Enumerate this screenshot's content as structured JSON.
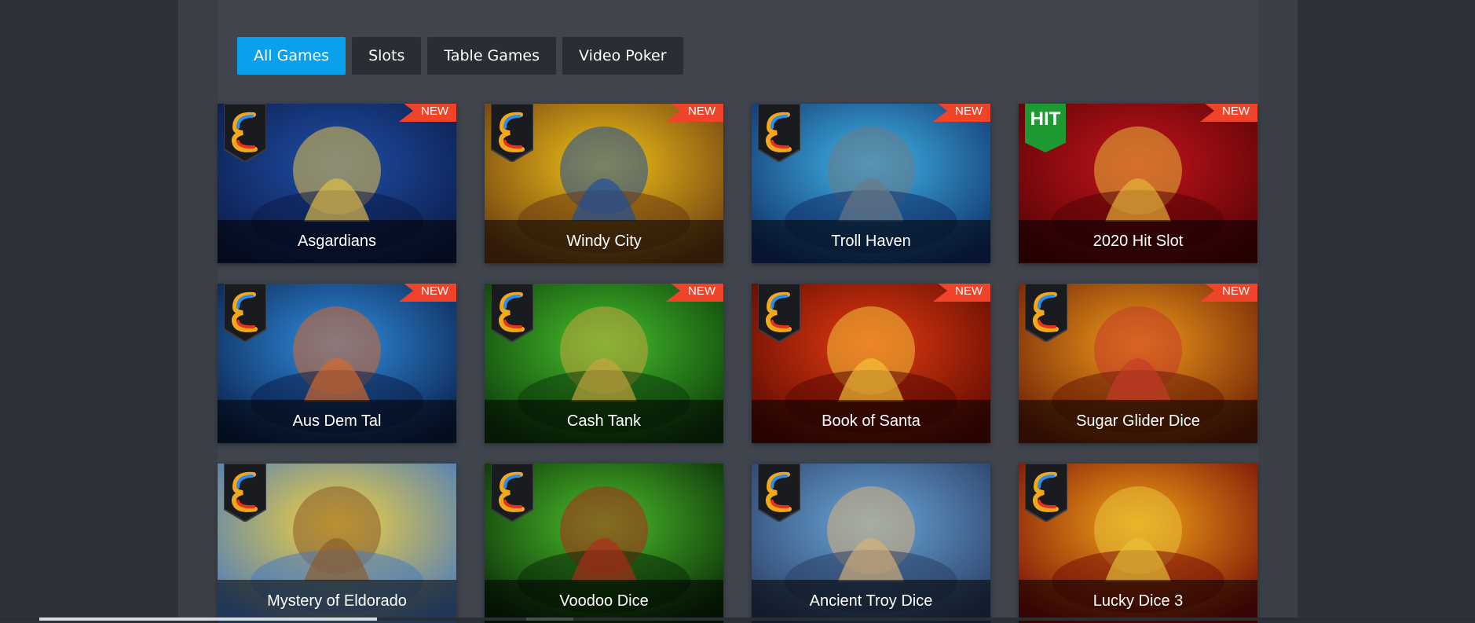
{
  "tabs": [
    {
      "label": "All Games",
      "active": true
    },
    {
      "label": "Slots",
      "active": false
    },
    {
      "label": "Table Games",
      "active": false
    },
    {
      "label": "Video Poker",
      "active": false
    }
  ],
  "badges": {
    "new": "NEW",
    "hit": "HIT"
  },
  "games": [
    {
      "title": "Asgardians",
      "new": true,
      "palette": [
        "#1e4fa8",
        "#0c1b48",
        "#e7c24a"
      ]
    },
    {
      "title": "Windy City",
      "new": true,
      "palette": [
        "#f1c417",
        "#6b3a12",
        "#1a4fa0"
      ]
    },
    {
      "title": "Troll Haven",
      "new": true,
      "palette": [
        "#3fb6e8",
        "#10306a",
        "#6b7a86"
      ]
    },
    {
      "title": "2020 Hit Slot",
      "new": true,
      "hit": true,
      "palette": [
        "#c3141a",
        "#560306",
        "#e8b93a"
      ]
    },
    {
      "title": "Aus Dem Tal",
      "new": true,
      "palette": [
        "#2f8fe0",
        "#0b1f4a",
        "#d8682a"
      ]
    },
    {
      "title": "Cash Tank",
      "new": true,
      "palette": [
        "#44c02a",
        "#0d3a0b",
        "#c9a640"
      ]
    },
    {
      "title": "Book of Santa",
      "new": true,
      "palette": [
        "#e43a0f",
        "#5a0a03",
        "#f4c43a"
      ]
    },
    {
      "title": "Sugar Glider Dice",
      "new": true,
      "palette": [
        "#f09a1a",
        "#6a1e06",
        "#c43b2a"
      ]
    },
    {
      "title": "Mystery of Eldorado",
      "new": false,
      "palette": [
        "#f5d33a",
        "#4a7ac0",
        "#8a5a2a"
      ]
    },
    {
      "title": "Voodoo Dice",
      "new": false,
      "palette": [
        "#4bbf2a",
        "#0a2c08",
        "#b02a1a"
      ]
    },
    {
      "title": "Ancient Troy Dice",
      "new": false,
      "palette": [
        "#6aa6d8",
        "#2a3f66",
        "#d8b27a"
      ]
    },
    {
      "title": "Lucky Dice 3",
      "new": false,
      "palette": [
        "#f2a417",
        "#7a0d08",
        "#e8c33a"
      ]
    }
  ]
}
